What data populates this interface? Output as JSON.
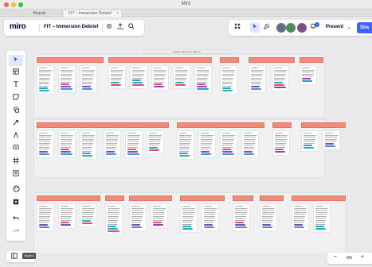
{
  "window": {
    "title": "Miro"
  },
  "tabs": [
    {
      "label": "Boards"
    },
    {
      "label": "FIT – Immersion Debrief",
      "close": "×"
    }
  ],
  "topbar": {
    "logo": "miro",
    "board_name": "FIT – Immersion Debrief",
    "icons": [
      "gear-icon",
      "upload-icon",
      "search-icon"
    ]
  },
  "rightbar": {
    "tools": [
      "apps-icon",
      "cursor-icon",
      "celebrate-icon"
    ],
    "notification_count": "1",
    "present_label": "Present",
    "present_chevron": "⌄",
    "share_label": "Sha"
  },
  "toolbar": {
    "items": [
      "select",
      "frames",
      "text",
      "sticky-note",
      "shapes",
      "pen",
      "pen-variant",
      "comment",
      "frame",
      "upload",
      "templates",
      "more",
      "undo",
      "redo"
    ]
  },
  "canvas": {
    "board_title": "Guided Immersion Debrief"
  },
  "bottom": {
    "tooltip": "Board",
    "zoom_minus": "−",
    "zoom_level": "9%",
    "zoom_plus": "+"
  },
  "colors": {
    "accent": "#4262ff",
    "header_salmon": "#f28b7a",
    "tag_pink": "#e84393",
    "tag_purple": "#8e44ad",
    "tag_blue": "#3498db",
    "tag_teal": "#1abc9c"
  }
}
